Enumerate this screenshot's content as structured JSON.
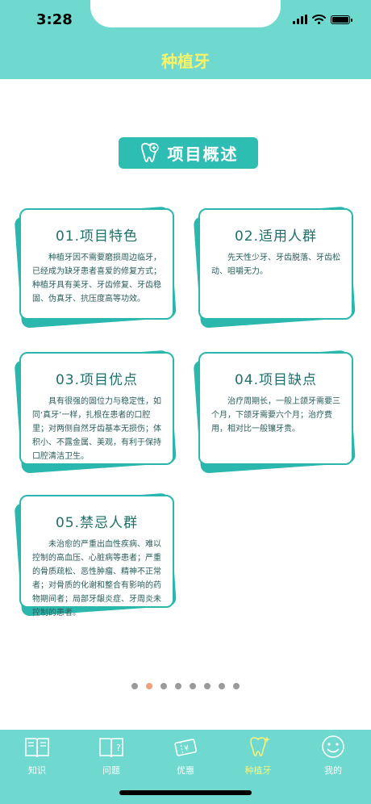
{
  "status": {
    "time": "3:28"
  },
  "header": {
    "title": "种植牙"
  },
  "section": {
    "title": "项目概述",
    "icon": "tooth-icon"
  },
  "cards": [
    {
      "title": "01.项目特色",
      "text": "种植牙因不需要磨损周边临牙，已经成为缺牙患者喜爱的修复方式；种植牙具有美牙、牙齿修复、牙齿稳固、伪真牙、抗压度高等功效。"
    },
    {
      "title": "02.适用人群",
      "text": "先天性少牙、牙齿脱落、牙齿松动、咀嚼无力。"
    },
    {
      "title": "03.项目优点",
      "text": "具有很强的固位力与稳定性，如同‘真牙’一样，扎根在患者的口腔里；对两侧自然牙齿基本无损伤；体积小、不露金属、美观，有利于保持口腔清洁卫生。"
    },
    {
      "title": "04.项目缺点",
      "text": "治疗周期长，一般上颌牙需要三个月，下颌牙需要六个月；治疗费用，相对比一般镶牙贵。"
    },
    {
      "title": "05.禁忌人群",
      "text": "未治愈的严重出血性疾病、难以控制的高血压、心脏病等患者；严重的骨质疏松、恶性肿瘤、精神不正常者；对骨质的化谢和整合有影响的药物期间者；局部牙龈炎症、牙周炎未控制的患者。"
    }
  ],
  "pager": {
    "total": 8,
    "active": 1
  },
  "tabbar": {
    "items": [
      {
        "label": "知识",
        "icon": "book-icon"
      },
      {
        "label": "问题",
        "icon": "question-book-icon"
      },
      {
        "label": "优惠",
        "icon": "coupon-icon"
      },
      {
        "label": "种植牙",
        "icon": "tooth-icon"
      },
      {
        "label": "我的",
        "icon": "smiley-icon"
      }
    ],
    "active_index": 3
  },
  "colors": {
    "teal": "#6fd9cf",
    "card_teal": "#2ab7ad",
    "title_yellow": "#f5f36a",
    "active_dot": "#f0a07c"
  }
}
